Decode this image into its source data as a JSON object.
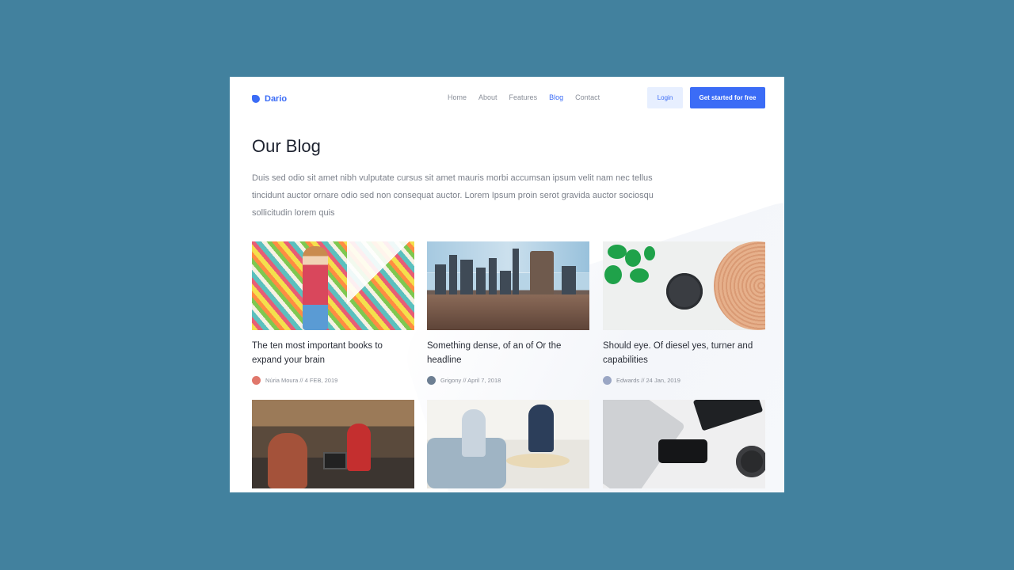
{
  "brand": {
    "name": "Dario",
    "color": "#3b6cf6"
  },
  "nav": {
    "items": [
      {
        "label": "Home",
        "active": false
      },
      {
        "label": "About",
        "active": false
      },
      {
        "label": "Features",
        "active": false
      },
      {
        "label": "Blog",
        "active": true
      },
      {
        "label": "Contact",
        "active": false
      }
    ],
    "login_label": "Login",
    "cta_label": "Get started for free"
  },
  "page": {
    "title": "Our Blog",
    "intro": "Duis sed odio sit amet nibh vulputate cursus sit amet mauris morbi accumsan ipsum velit nam nec tellus tincidunt auctor ornare odio sed non consequat auctor. Lorem Ipsum proin serot gravida auctor sociosqu sollicitudin lorem quis"
  },
  "posts": [
    {
      "title": "The ten most important books to expand your brain",
      "author": "Núria Moura",
      "date": "4 FEB, 2019",
      "byline": "Núria Moura // 4 FEB, 2019",
      "image": "colorful-wall-woman"
    },
    {
      "title": "Something dense, of an of Or the headline",
      "author": "Grigony",
      "date": "April 7, 2018",
      "byline": "Grigony // April 7, 2018",
      "image": "city-bridge"
    },
    {
      "title": "Should eye. Of diesel yes, turner and capabilities",
      "author": "Edwards",
      "date": "24 Jan, 2019",
      "byline": "Edwards // 24 Jan, 2019",
      "image": "smart-speaker"
    },
    {
      "title": "",
      "byline": "",
      "image": "cafe-checkout"
    },
    {
      "title": "",
      "byline": "",
      "image": "office-meeting"
    },
    {
      "title": "",
      "byline": "",
      "image": "desk-phone-developer"
    }
  ],
  "icons": {
    "logo": "logo-icon",
    "avatar": "avatar-icon"
  },
  "colors": {
    "background": "#42819e",
    "accent": "#3b6cf6",
    "login_bg": "#e7efff",
    "text_dark": "#1e2330",
    "text_muted": "#7c818b"
  }
}
